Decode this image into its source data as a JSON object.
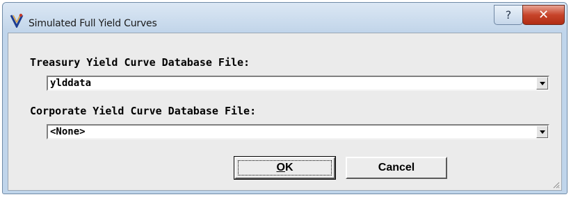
{
  "window": {
    "title": "Simulated Full Yield Curves",
    "help_glyph": "?",
    "close_glyph": "✕",
    "colors": {
      "frame": "#c0d5eb",
      "client": "#ebebeb",
      "close": "#c7442a"
    }
  },
  "form": {
    "treasury_label": "Treasury Yield Curve Database File:",
    "treasury_value": "ylddata",
    "corporate_label": "Corporate Yield Curve Database File:",
    "corporate_value": "<None>"
  },
  "buttons": {
    "ok_accel": "O",
    "ok_rest": "K",
    "cancel": "Cancel"
  },
  "icons": [
    "app-icon",
    "help-icon",
    "close-icon",
    "dropdown-arrow-icon",
    "resize-grip-icon"
  ]
}
